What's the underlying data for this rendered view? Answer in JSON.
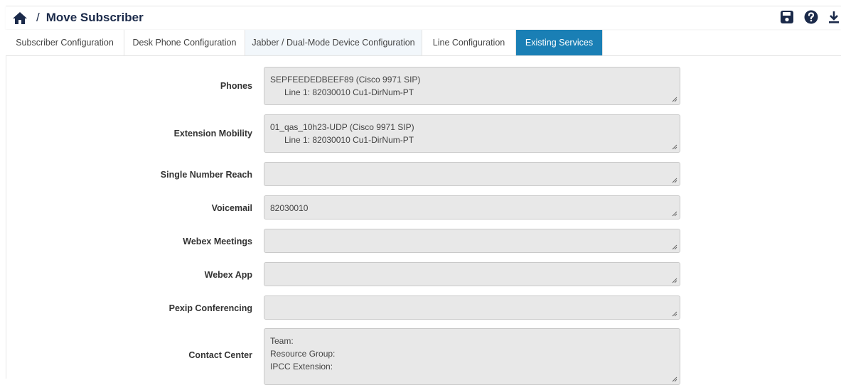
{
  "header": {
    "title": "Move Subscriber",
    "separator": "/"
  },
  "tabs": [
    {
      "label": "Subscriber Configuration"
    },
    {
      "label": "Desk Phone Configuration"
    },
    {
      "label": "Jabber / Dual-Mode Device Configuration"
    },
    {
      "label": "Line Configuration"
    },
    {
      "label": "Existing Services"
    }
  ],
  "colors": {
    "active_tab": "#1a7fb5",
    "title": "#1b2a4a",
    "field_bg": "#e8e8e8"
  },
  "fields": {
    "phones": {
      "label": "Phones",
      "line1": "SEPFEEDEDBEEF89 (Cisco 9971 SIP)",
      "line2": "Line 1: 82030010 Cu1-DirNum-PT"
    },
    "extension_mobility": {
      "label": "Extension Mobility",
      "line1": "01_qas_10h23-UDP (Cisco 9971 SIP)",
      "line2": "Line 1: 82030010 Cu1-DirNum-PT"
    },
    "single_number_reach": {
      "label": "Single Number Reach"
    },
    "voicemail": {
      "label": "Voicemail",
      "value": "82030010"
    },
    "webex_meetings": {
      "label": "Webex Meetings"
    },
    "webex_app": {
      "label": "Webex App"
    },
    "pexip": {
      "label": "Pexip Conferencing"
    },
    "contact_center": {
      "label": "Contact Center",
      "line1": "Team:",
      "line2": "Resource Group:",
      "line3": "IPCC Extension:"
    }
  },
  "icons": [
    "home-icon",
    "save-icon",
    "help-icon",
    "download-icon",
    "resize-grip-icon"
  ]
}
